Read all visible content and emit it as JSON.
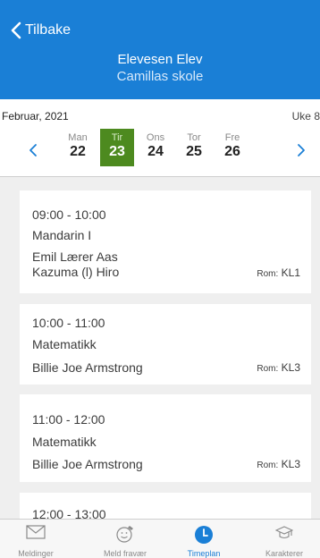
{
  "header": {
    "back_label": "Tilbake",
    "student_name": "Elevesen Elev",
    "school_name": "Camillas skole"
  },
  "calendar": {
    "month_label": "Februar, 2021",
    "week_label": "Uke 8",
    "selected_color": "#4d8a1f",
    "days": [
      {
        "name": "Man",
        "date": "22"
      },
      {
        "name": "Tir",
        "date": "23",
        "selected": true
      },
      {
        "name": "Ons",
        "date": "24"
      },
      {
        "name": "Tor",
        "date": "25"
      },
      {
        "name": "Fre",
        "date": "26"
      }
    ]
  },
  "lessons": [
    {
      "time": "09:00 - 10:00",
      "subject": "Mandarin I",
      "teacher": "Emil Lærer Aas",
      "teacher2": "Kazuma (l) Hiro",
      "room_label": "Rom:",
      "room": "KL1"
    },
    {
      "time": "10:00 - 11:00",
      "subject": "Matematikk",
      "teacher": "Billie Joe Armstrong",
      "room_label": "Rom:",
      "room": "KL3"
    },
    {
      "time": "11:00 - 12:00",
      "subject": "Matematikk",
      "teacher": "Billie Joe Armstrong",
      "room_label": "Rom:",
      "room": "KL3"
    },
    {
      "time": "12:00 - 13:00"
    }
  ],
  "tabs": [
    {
      "label": "Meldinger",
      "icon": "envelope-icon"
    },
    {
      "label": "Meld fravær",
      "icon": "smiley-icon"
    },
    {
      "label": "Timeplan",
      "icon": "clock-icon",
      "active": true
    },
    {
      "label": "Karakterer",
      "icon": "graduation-cap-icon"
    }
  ],
  "colors": {
    "header_bg": "#1a7fd6",
    "accent": "#1a7fd6"
  }
}
